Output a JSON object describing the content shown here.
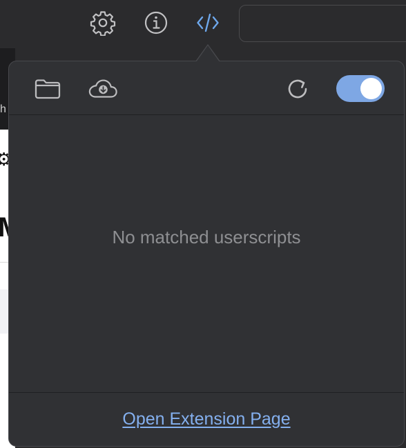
{
  "toolbar": {
    "buttons": [
      {
        "name": "settings",
        "icon": "gear-icon"
      },
      {
        "name": "info",
        "icon": "info-icon"
      },
      {
        "name": "extension",
        "icon": "code-icon",
        "active": true
      }
    ],
    "address": ""
  },
  "background": {
    "peek_text_1": "h",
    "peek_text_2": "⚙",
    "peek_text_3": "M"
  },
  "popup": {
    "header": {
      "buttons": [
        {
          "name": "open-folder",
          "icon": "folder-icon"
        },
        {
          "name": "download",
          "icon": "cloud-download-icon"
        },
        {
          "name": "refresh",
          "icon": "refresh-icon"
        }
      ],
      "toggle_on": true
    },
    "empty_message": "No matched userscripts",
    "footer_link": "Open Extension Page"
  },
  "colors": {
    "background": "#2b2b2d",
    "popup_bg": "#303134",
    "accent": "#7ea7e4",
    "link": "#84b0ef",
    "icon": "#bdbdbf",
    "muted_text": "#8e8f92"
  }
}
